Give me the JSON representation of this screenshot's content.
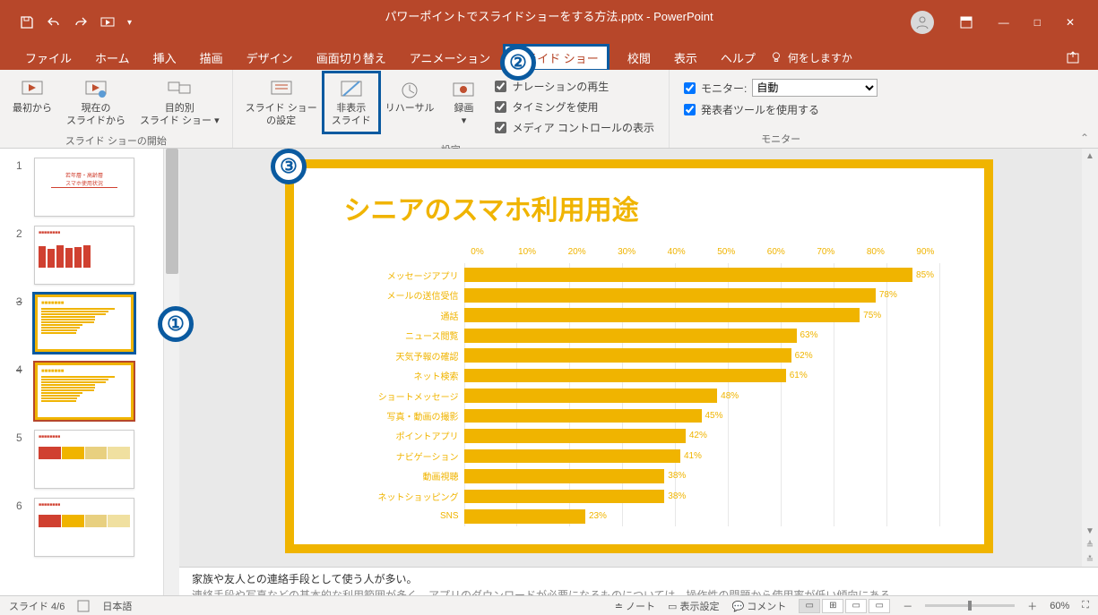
{
  "app": {
    "title": "パワーポイントでスライドショーをする方法.pptx  -  PowerPoint"
  },
  "window_controls": {
    "minimize": "―",
    "maximize": "□",
    "close": "✕",
    "ribbon_display": "⬚"
  },
  "menubar": {
    "items": [
      "ファイル",
      "ホーム",
      "挿入",
      "描画",
      "デザイン",
      "画面切り替え",
      "アニメーション",
      "スライド ショー",
      "",
      "校閲",
      "表示",
      "ヘルプ"
    ],
    "active_index": 7,
    "tell_me": "何をしますか"
  },
  "ribbon": {
    "group1": {
      "label": "スライド ショーの開始",
      "btn1": {
        "line1": "最初から",
        "line2": ""
      },
      "btn2": {
        "line1": "現在の",
        "line2": "スライドから"
      },
      "btn3": {
        "line1": "目的別",
        "line2": "スライド ショー ▾"
      }
    },
    "group2": {
      "label": "設定",
      "btn1": {
        "line1": "スライド ショー",
        "line2": "の設定"
      },
      "btn2": {
        "line1": "非表示",
        "line2": "スライド"
      },
      "btn3": {
        "line1": "リハーサル",
        "line2": ""
      },
      "btn4": {
        "line1": "録画",
        "line2": "▾"
      },
      "checks": [
        "ナレーションの再生",
        "タイミングを使用",
        "メディア コントロールの表示"
      ]
    },
    "group3": {
      "label": "モニター",
      "monitor_label": "モニター:",
      "monitor_value": "自動",
      "presenter_check": "発表者ツールを使用する"
    }
  },
  "slide": {
    "title": "シニアのスマホ利用用途"
  },
  "chart_data": {
    "type": "bar",
    "orientation": "horizontal",
    "categories": [
      "メッセージアプリ",
      "メールの送信受信",
      "通話",
      "ニュース閲覧",
      "天気予報の確認",
      "ネット検索",
      "ショートメッセージ",
      "写真・動画の撮影",
      "ポイントアプリ",
      "ナビゲーション",
      "動画視聴",
      "ネットショッピング",
      "SNS"
    ],
    "values": [
      85,
      78,
      75,
      63,
      62,
      61,
      48,
      45,
      42,
      41,
      38,
      38,
      23
    ],
    "value_suffix": "%",
    "xlabel": "",
    "ylabel": "",
    "xaxis_ticks": [
      "0%",
      "10%",
      "20%",
      "30%",
      "40%",
      "50%",
      "60%",
      "70%",
      "80%",
      "90%"
    ],
    "xlim": [
      0,
      100
    ],
    "title": ""
  },
  "notes": {
    "line1": "家族や友人との連絡手段として使う人が多い。",
    "line2": "連絡手段や写真などの基本的な利用範囲が多く　アプリのダウンロードが必要になるものについては　操作性の問題から使用率が低い傾向にある"
  },
  "statusbar": {
    "slide_pos": "スライド 4/6",
    "lang": "日本語",
    "notes_btn": "ノート",
    "display_btn": "表示設定",
    "comment_btn": "コメント",
    "zoom_pct": "60%",
    "zoom_minus": "－",
    "zoom_plus": "＋"
  },
  "thumbs": {
    "nums": [
      "1",
      "2",
      "3",
      "4",
      "5",
      "6"
    ]
  },
  "annotations": {
    "a1": "①",
    "a2": "②",
    "a3": "③"
  }
}
